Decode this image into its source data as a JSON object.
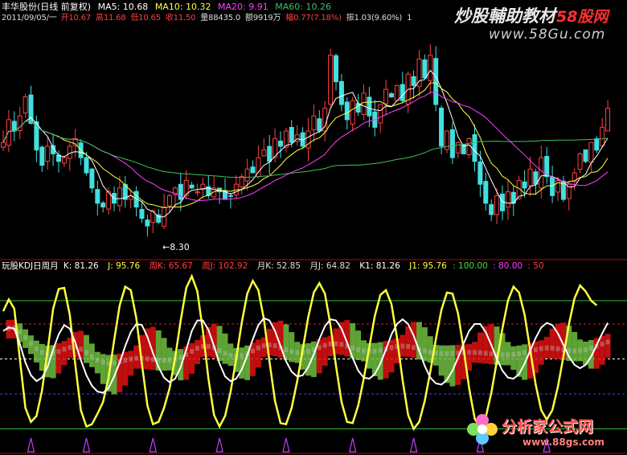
{
  "colors": {
    "bg": "#000000",
    "up": "#ff4040",
    "down": "#40e0e0",
    "ma5": "#ffffff",
    "ma10": "#ffff40",
    "ma20": "#ff40ff",
    "ma60": "#40c060",
    "kdj_k": "#ffffff",
    "kdj_j": "#ffff40",
    "band_red": "#e01010",
    "band_green": "#70c040",
    "band_white": "#c8c8c8",
    "divider": "#c00000",
    "ref_green": "#30c030",
    "ref_red": "#d02020",
    "ref_blue": "#4040ff",
    "marker_purple": "#c040ff"
  },
  "price_panel": {
    "header": {
      "stock": "丰华股份(日线 前复权)",
      "ma5": "MA5: 10.68",
      "ma10": "MA10: 10.32",
      "ma20": "MA20: 9.91",
      "ma60": "MA60: 10.26"
    },
    "quote": {
      "date": "2011/09/05/一",
      "open": "开10.67",
      "high": "高11.68",
      "low": "低10.65",
      "close": "收11.50",
      "volume": "量88435.0",
      "amount": "额9919万",
      "change": "幅0.77(7.18%)",
      "amplitude": "振1.03(9.60%)",
      "tail": "1"
    },
    "low_label": "←8.30"
  },
  "kdj_panel": {
    "header": {
      "name": "玩股KDJ日周月",
      "k": "K: 81.26",
      "j": "J: 95.76",
      "wk": "周K: 65.67",
      "wj": "周J: 102.92",
      "mk": "月K: 52.85",
      "mj": "月J: 64.82",
      "k1": "K1: 81.26",
      "j1": "J1: 95.76",
      "l100": ": 100.00",
      "l80": ": 80.00",
      "l50": ": 50"
    }
  },
  "watermarks": {
    "top_cn": "炒股輔助教材",
    "top_brand": "58股网",
    "top_url": "www.58Gu.com",
    "bottom_cn": "分析家公式网",
    "bottom_url": "www.88gs.com"
  },
  "chart_data": [
    {
      "type": "candlestick",
      "title": "丰华股份(日线 前复权)",
      "min_price_label": 8.3,
      "last": {
        "open": 10.67,
        "high": 11.68,
        "low": 10.65,
        "close": 11.5
      },
      "moving_averages": {
        "MA5": 10.68,
        "MA10": 10.32,
        "MA20": 9.91,
        "MA60": 10.26
      },
      "closes": [
        10.6,
        11.2,
        10.9,
        11.3,
        11.8,
        11.1,
        10.4,
        10.0,
        10.5,
        10.3,
        10.1,
        10.2,
        10.5,
        10.7,
        10.2,
        9.8,
        9.4,
        9.0,
        8.9,
        9.3,
        9.0,
        9.4,
        9.1,
        9.2,
        8.9,
        8.6,
        8.4,
        8.8,
        8.5,
        8.9,
        9.2,
        9.4,
        9.1,
        9.6,
        9.4,
        9.3,
        9.5,
        9.2,
        9.4,
        9.3,
        9.1,
        9.2,
        9.5,
        9.7,
        9.9,
        9.8,
        10.2,
        10.4,
        10.1,
        10.7,
        10.5,
        10.9,
        10.6,
        10.8,
        10.5,
        10.9,
        11.3,
        10.9,
        11.5,
        12.9,
        12.2,
        11.6,
        11.2,
        11.7,
        11.4,
        11.9,
        11.3,
        11.0,
        11.6,
        12.0,
        11.8,
        12.1,
        11.7,
        12.4,
        12.1,
        12.8,
        12.3,
        12.9,
        11.6,
        10.5,
        10.9,
        10.2,
        10.6,
        10.3,
        10.7,
        10.1,
        9.5,
        9.0,
        8.7,
        9.2,
        8.8,
        9.3,
        9.0,
        9.6,
        9.4,
        9.9,
        9.5,
        10.2,
        9.7,
        9.2,
        9.6,
        9.1,
        9.5,
        9.8,
        10.3,
        10.1,
        10.6,
        10.4,
        11.0,
        11.5
      ]
    },
    {
      "type": "line",
      "title": "玩股KDJ日周月",
      "ylim": [
        0,
        100
      ],
      "reference_lines": [
        100,
        80,
        50
      ],
      "last_values": {
        "K": 81.26,
        "J": 95.76,
        "周K": 65.67,
        "周J": 102.92,
        "月K": 52.85,
        "月J": 64.82,
        "K1": 81.26,
        "J1": 95.76
      },
      "series": [
        {
          "name": "K",
          "values": [
            74,
            77,
            76,
            63,
            47,
            36,
            31,
            34,
            43,
            58,
            71,
            79,
            76,
            64,
            49,
            36,
            27,
            22,
            21,
            25,
            35,
            47,
            61,
            73,
            80,
            79,
            69,
            55,
            43,
            34,
            30,
            33,
            43,
            58,
            74,
            83,
            83,
            75,
            61,
            46,
            35,
            31,
            33,
            41,
            53,
            67,
            79,
            85,
            83,
            74,
            61,
            48,
            39,
            35,
            36,
            43,
            54,
            67,
            78,
            84,
            83,
            76,
            64,
            51,
            40,
            34,
            33,
            37,
            46,
            58,
            71,
            80,
            84,
            80,
            70,
            57,
            44,
            34,
            29,
            28,
            32,
            40,
            51,
            63,
            74,
            80,
            80,
            73,
            62,
            50,
            40,
            34,
            33,
            37,
            46,
            57,
            68,
            77,
            81,
            79,
            72,
            62,
            52,
            45,
            42,
            45,
            52,
            62,
            72,
            81
          ]
        },
        {
          "name": "J",
          "values": [
            91,
            101,
            93,
            50,
            8,
            -4,
            1,
            23,
            57,
            93,
            110,
            111,
            88,
            45,
            6,
            -8,
            -6,
            3,
            13,
            34,
            66,
            96,
            112,
            109,
            85,
            46,
            10,
            -6,
            -4,
            8,
            25,
            51,
            83,
            111,
            121,
            108,
            74,
            33,
            2,
            -8,
            1,
            22,
            50,
            81,
            106,
            117,
            109,
            84,
            48,
            14,
            -5,
            -6,
            8,
            31,
            58,
            86,
            107,
            115,
            106,
            79,
            44,
            13,
            -4,
            -5,
            10,
            33,
            60,
            87,
            105,
            109,
            97,
            68,
            32,
            2,
            -10,
            -4,
            14,
            39,
            67,
            92,
            107,
            106,
            89,
            59,
            25,
            -1,
            -10,
            0,
            21,
            48,
            76,
            100,
            112,
            107,
            88,
            58,
            28,
            6,
            -2,
            6,
            26,
            52,
            80,
            102,
            113,
            108,
            100,
            96
          ]
        }
      ]
    }
  ]
}
